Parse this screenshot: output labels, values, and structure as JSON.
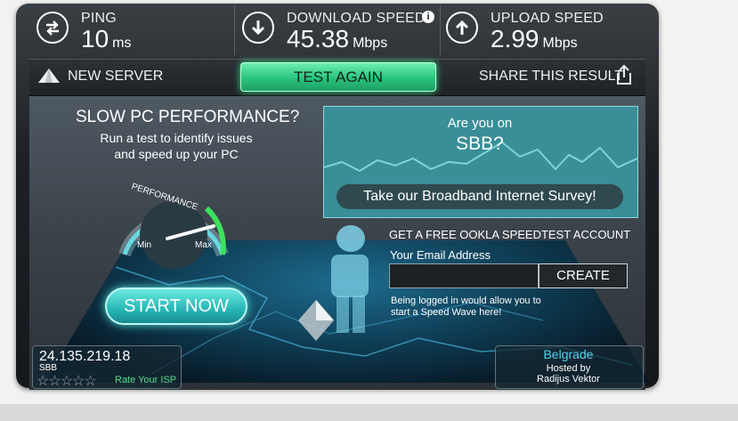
{
  "header": {
    "ping": {
      "label": "PING",
      "value": "10",
      "unit": "ms",
      "icon": "ping-icon"
    },
    "download": {
      "label": "DOWNLOAD SPEED",
      "value": "45.38",
      "unit": "Mbps",
      "icon": "download-arrow-icon"
    },
    "upload": {
      "label": "UPLOAD SPEED",
      "value": "2.99",
      "unit": "Mbps",
      "icon": "upload-arrow-icon"
    }
  },
  "actions": {
    "new_server": "NEW SERVER",
    "test_again": "TEST AGAIN",
    "share": "SHARE THIS RESULT"
  },
  "promo": {
    "title": "SLOW PC PERFORMANCE?",
    "line1": "Run a test to identify issues",
    "line2": "and speed up your PC",
    "gauge_label": "PERFORMANCE",
    "gauge_min": "Min",
    "gauge_max": "Max",
    "start_now": "START NOW"
  },
  "survey": {
    "question": "Are you on",
    "isp": "SBB?",
    "button": "Take our Broadband Internet Survey!"
  },
  "account": {
    "title": "GET A FREE OOKLA SPEEDTEST ACCOUNT",
    "email_label": "Your Email Address",
    "email_value": "",
    "create": "CREATE",
    "note": "Being logged in would allow you to start a Speed Wave here!"
  },
  "client": {
    "ip": "24.135.219.18",
    "isp": "SBB",
    "rating_stars": 0,
    "rate_label": "Rate Your ISP"
  },
  "server": {
    "city": "Belgrade",
    "hosted_by": "Hosted by",
    "host": "Radijus Vektor"
  },
  "colors": {
    "accent_green": "#29c27c",
    "teal": "#3a8e98",
    "city_blue": "#4fd6f0"
  }
}
